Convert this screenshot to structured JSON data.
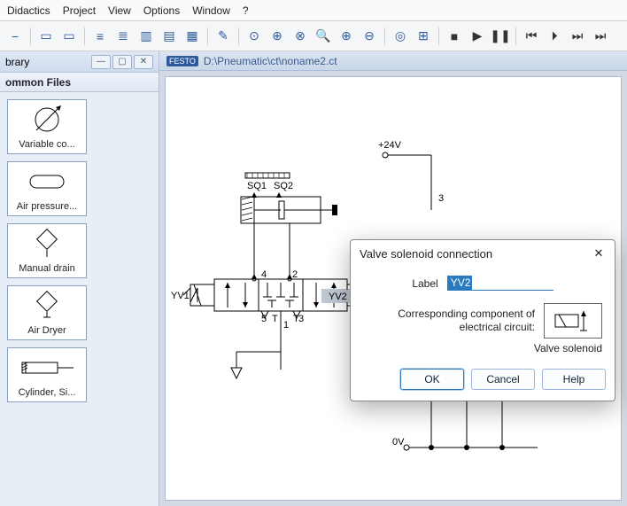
{
  "menu": {
    "items": [
      "Didactics",
      "Project",
      "View",
      "Options",
      "Window",
      "?"
    ]
  },
  "toolbar_icons": [
    "dash",
    "doc",
    "link1",
    "link2",
    "align1",
    "align2",
    "align3",
    "align4",
    "align5",
    "pen",
    "circ-1",
    "circ-a",
    "circ-b",
    "glass",
    "zoom-in",
    "zoom-out",
    "target",
    "nav",
    "stop",
    "play",
    "pause",
    "rew",
    "ffwd",
    "next",
    "end"
  ],
  "sidebar": {
    "header": "brary",
    "title": "ommon Files",
    "items": [
      {
        "label": "Variable co..."
      },
      {
        "label": "Air pressure..."
      },
      {
        "label": "Manual drain"
      },
      {
        "label": "Air Dryer"
      },
      {
        "label": "Cylinder, Si..."
      }
    ]
  },
  "document": {
    "path": "D:\\Pneumatic\\ct\\noname2.ct"
  },
  "schematic": {
    "sq1": "SQ1",
    "sq2": "SQ2",
    "yv1": "YV1",
    "yv2": "YV2",
    "ports": {
      "p1": "1",
      "p2": "2",
      "p3": "3",
      "p4": "4",
      "p5": "5",
      "pt": "T"
    },
    "plus24": "+24V",
    "zero": "0V",
    "wire3": "3"
  },
  "dialog": {
    "title": "Valve solenoid connection",
    "label_text": "Label",
    "label_value": "YV2",
    "component_text": "Corresponding component of electrical circuit:",
    "component_caption": "Valve solenoid",
    "buttons": {
      "ok": "OK",
      "cancel": "Cancel",
      "help": "Help"
    }
  }
}
